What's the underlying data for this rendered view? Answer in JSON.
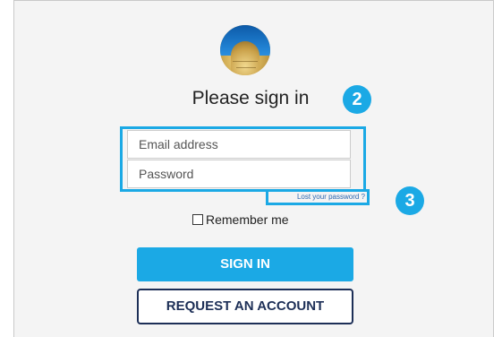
{
  "signin": {
    "title": "Please sign in",
    "email": {
      "placeholder": "Email address"
    },
    "password": {
      "placeholder": "Password"
    },
    "lost_password": "Lost your password ?",
    "remember_me": "Remember me",
    "sign_in_button": "SIGN IN",
    "request_account_button": "REQUEST AN ACCOUNT"
  },
  "callouts": {
    "badge_2": "2",
    "badge_3": "3"
  },
  "colors": {
    "accent": "#1ba9e5",
    "navy": "#1d2f57",
    "link": "#2a66b0"
  },
  "icons": {
    "logo": "blue-gold-coin-logo",
    "checkbox": "checkbox-unchecked"
  }
}
